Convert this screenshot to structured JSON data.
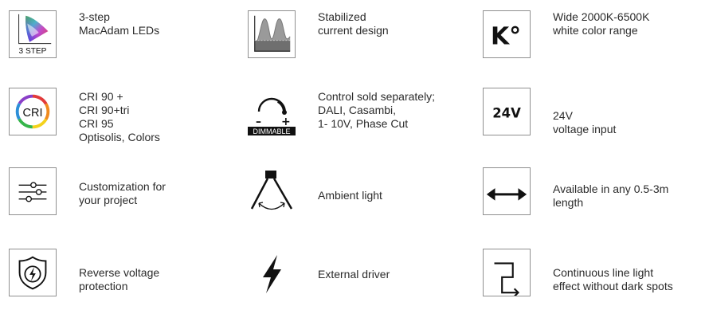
{
  "features": [
    {
      "id": "macadam",
      "lines": [
        "3-step",
        "MacAdam LEDs"
      ],
      "icon_text": "3 STEP",
      "icon": "cie-chromaticity-icon"
    },
    {
      "id": "stabilized",
      "lines": [
        "Stabilized",
        "current design"
      ],
      "icon": "stabilized-current-graph-icon"
    },
    {
      "id": "kelvin",
      "lines": [
        "Wide 2000K-6500K",
        "white color range"
      ],
      "icon_text": "K°",
      "icon": "kelvin-icon"
    },
    {
      "id": "cri",
      "lines": [
        "CRI 90 +",
        "CRI 90+tri",
        "CRI 95",
        "Optisolis, Colors"
      ],
      "icon_text": "CRI",
      "icon": "cri-color-ring-icon"
    },
    {
      "id": "dimmable",
      "lines": [
        "Control sold separately;",
        "DALI, Casambi,",
        "1- 10V, Phase Cut"
      ],
      "icon_text": "DIMMABLE",
      "minus": "–",
      "plus": "+",
      "icon": "dimmer-knob-icon"
    },
    {
      "id": "voltage",
      "lines": [
        "24V",
        "voltage input"
      ],
      "icon_text": "24V",
      "icon": "voltage-24v-icon"
    },
    {
      "id": "custom",
      "lines": [
        "Customization for",
        "your project"
      ],
      "icon": "sliders-icon"
    },
    {
      "id": "ambient",
      "lines": [
        "Ambient light"
      ],
      "icon": "ambient-light-icon"
    },
    {
      "id": "length",
      "lines": [
        "Available in any 0.5-3m",
        "length"
      ],
      "icon": "double-arrow-icon"
    },
    {
      "id": "reverse",
      "lines": [
        "Reverse voltage",
        "protection"
      ],
      "icon": "shield-lightning-icon"
    },
    {
      "id": "driver",
      "lines": [
        "External driver"
      ],
      "icon": "lightning-bolt-icon"
    },
    {
      "id": "continuous",
      "lines": [
        "Continuous line light",
        "effect without dark spots"
      ],
      "icon": "continuous-line-icon"
    }
  ],
  "colors": {
    "text": "#2b2b2b",
    "border": "#8f8f8f",
    "icon": "#111111",
    "graph_fill": "#9a9a9a"
  }
}
